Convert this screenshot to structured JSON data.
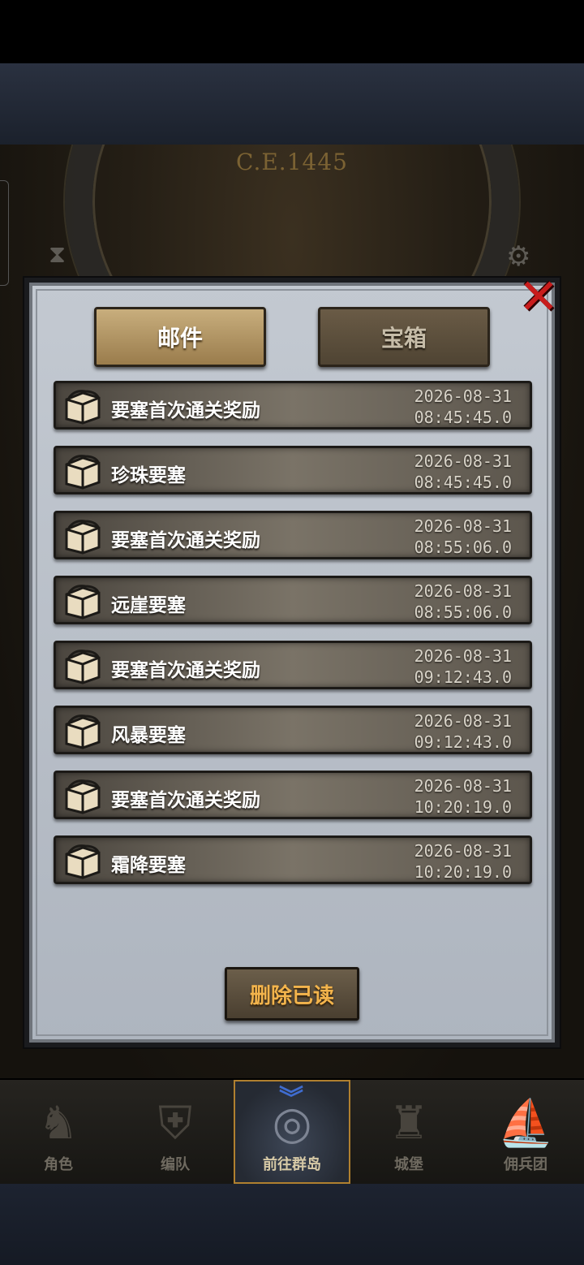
{
  "background": {
    "calendar_year": "C.E.1445"
  },
  "mail_window": {
    "tabs": [
      {
        "label": "邮件",
        "active": true
      },
      {
        "label": "宝箱",
        "active": false
      }
    ],
    "items": [
      {
        "title": "要塞首次通关奖励",
        "date": "2026-08-31",
        "time": "08:45:45.0",
        "icon": "treasure-chest-icon"
      },
      {
        "title": "珍珠要塞",
        "date": "2026-08-31",
        "time": "08:45:45.0",
        "icon": "treasure-chest-icon"
      },
      {
        "title": "要塞首次通关奖励",
        "date": "2026-08-31",
        "time": "08:55:06.0",
        "icon": "treasure-chest-icon"
      },
      {
        "title": "远崖要塞",
        "date": "2026-08-31",
        "time": "08:55:06.0",
        "icon": "treasure-chest-icon"
      },
      {
        "title": "要塞首次通关奖励",
        "date": "2026-08-31",
        "time": "09:12:43.0",
        "icon": "treasure-chest-icon"
      },
      {
        "title": "风暴要塞",
        "date": "2026-08-31",
        "time": "09:12:43.0",
        "icon": "treasure-chest-icon"
      },
      {
        "title": "要塞首次通关奖励",
        "date": "2026-08-31",
        "time": "10:20:19.0",
        "icon": "treasure-chest-icon"
      },
      {
        "title": "霜降要塞",
        "date": "2026-08-31",
        "time": "10:20:19.0",
        "icon": "treasure-chest-icon"
      }
    ],
    "delete_read_label": "删除已读",
    "close_icon": "close-icon",
    "accent_color": "#f3b44c",
    "close_color": "#c81c1c"
  },
  "bottom_nav": {
    "items": [
      {
        "label": "角色",
        "icon": "knight-icon",
        "active": false
      },
      {
        "label": "编队",
        "icon": "helmet-icon",
        "active": false
      },
      {
        "label": "前往群岛",
        "icon": "compass-globe-icon",
        "active": true
      },
      {
        "label": "城堡",
        "icon": "castle-icon",
        "active": false
      },
      {
        "label": "佣兵团",
        "icon": "ship-icon",
        "active": false
      }
    ]
  }
}
